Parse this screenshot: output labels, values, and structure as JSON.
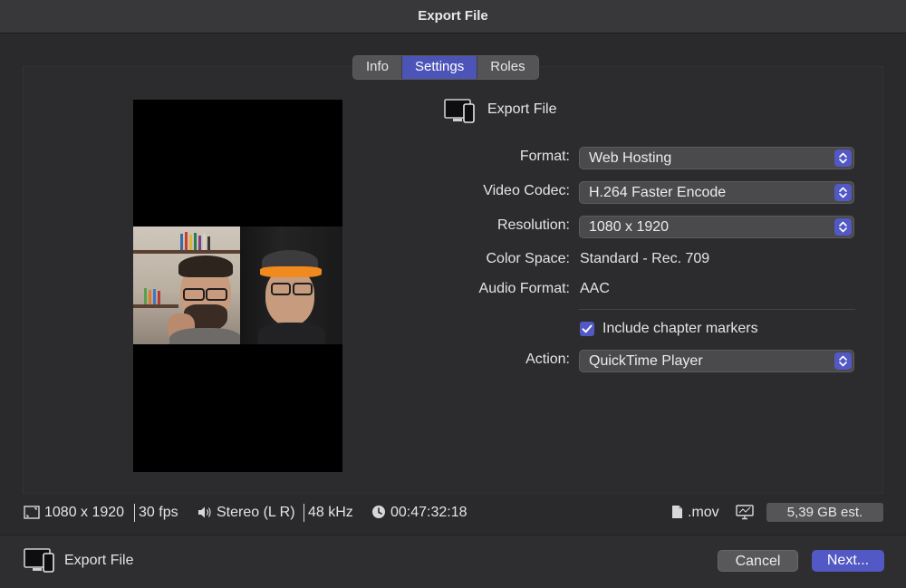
{
  "window": {
    "title": "Export File"
  },
  "tabs": [
    {
      "label": "Info"
    },
    {
      "label": "Settings",
      "active": true
    },
    {
      "label": "Roles"
    }
  ],
  "header": {
    "title": "Export File",
    "icon": "display-phone-icon"
  },
  "settings": {
    "format": {
      "label": "Format:",
      "value": "Web Hosting"
    },
    "video_codec": {
      "label": "Video Codec:",
      "value": "H.264 Faster Encode"
    },
    "resolution": {
      "label": "Resolution:",
      "value": "1080 x 1920"
    },
    "color_space": {
      "label": "Color Space:",
      "value": "Standard - Rec. 709"
    },
    "audio_format": {
      "label": "Audio Format:",
      "value": "AAC"
    },
    "chapter_markers": {
      "label": "Include chapter markers",
      "checked": true
    },
    "action": {
      "label": "Action:",
      "value": "QuickTime Player"
    }
  },
  "status_bar": {
    "resolution": "1080 x 1920",
    "fps": "30 fps",
    "audio": "Stereo (L R)",
    "sample_rate": "48 kHz",
    "duration": "00:47:32:18",
    "extension": ".mov",
    "estimate": "5,39 GB est."
  },
  "footer": {
    "label": "Export File",
    "cancel": "Cancel",
    "next": "Next..."
  },
  "colors": {
    "accent": "#5258c4",
    "window_bg": "#2a2a2c",
    "titlebar": "#38383a"
  }
}
